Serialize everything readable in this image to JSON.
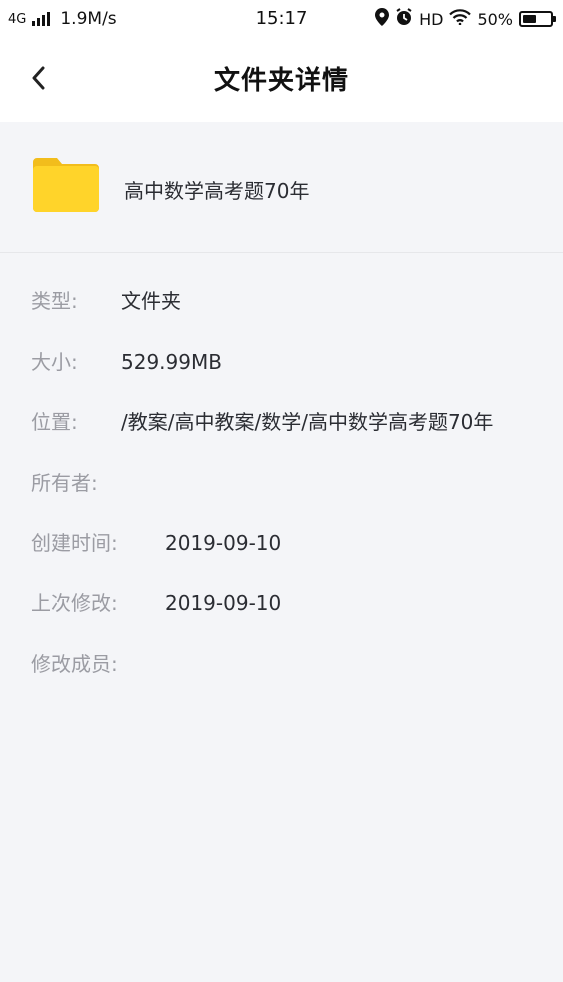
{
  "status_bar": {
    "network": "4G",
    "speed": "1.9M/s",
    "time": "15:17",
    "hd": "HD",
    "battery": "50%",
    "battery_level": 0.5
  },
  "nav": {
    "title": "文件夹详情",
    "back_icon": "chevron-left-icon"
  },
  "folder": {
    "name": "高中数学高考题70年",
    "icon": "folder-icon",
    "icon_color": "#ffd42a"
  },
  "details": [
    {
      "label": "类型:",
      "value": "文件夹"
    },
    {
      "label": "大小:",
      "value": "529.99MB"
    },
    {
      "label": "位置:",
      "value": "/教案/高中教案/数学/高中数学高考题70年"
    },
    {
      "label": "所有者:",
      "value": ""
    },
    {
      "label": "创建时间:",
      "value": "2019-09-10"
    },
    {
      "label": "上次修改:",
      "value": "2019-09-10"
    },
    {
      "label": "修改成员:",
      "value": ""
    }
  ]
}
